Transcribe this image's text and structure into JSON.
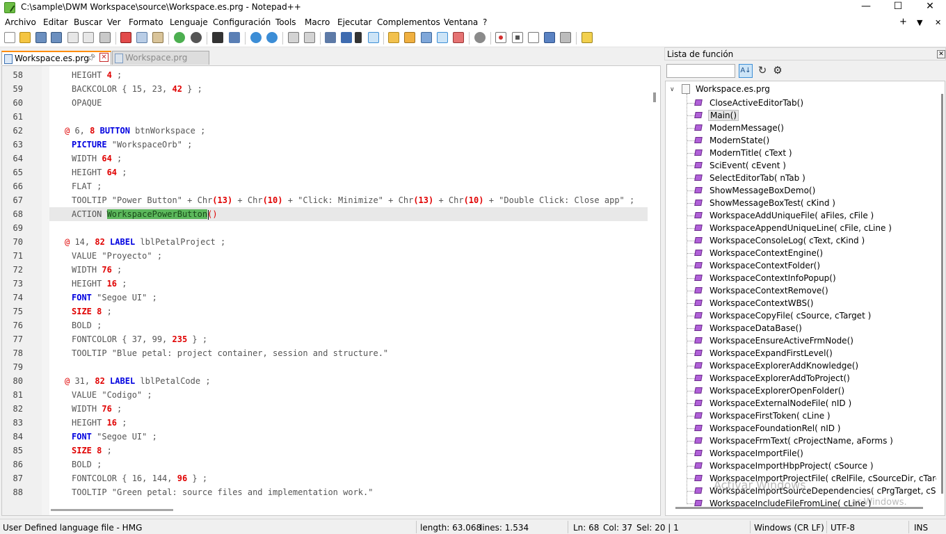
{
  "window": {
    "title": "C:\\sample\\DWM Workspace\\source\\Workspace.es.prg - Notepad++",
    "minimize": "—",
    "maximize": "☐",
    "close": "✕"
  },
  "menu": {
    "items": [
      "Archivo",
      "Editar",
      "Buscar",
      "Ver",
      "Formato",
      "Lenguaje",
      "Configuración",
      "Tools",
      "Macro",
      "Ejecutar",
      "Complementos",
      "Ventana",
      "?"
    ],
    "right": [
      "+",
      "▼",
      "✕"
    ]
  },
  "toolbar": {
    "icons": [
      "new-file-icon",
      "open-file-icon",
      "save-icon",
      "save-all-icon",
      "close-icon",
      "close-all-icon",
      "print-icon",
      "cut-icon",
      "copy-icon",
      "paste-icon",
      "undo-icon",
      "redo-icon",
      "find-icon",
      "replace-icon",
      "zoom-in-icon",
      "zoom-out-icon",
      "sync-v-icon",
      "sync-h-icon",
      "word-wrap-icon",
      "show-all-chars-icon",
      "indent-guide-icon",
      "lang-icon",
      "doc-map-icon",
      "doc-list-icon",
      "function-list-icon",
      "folder-workspace-icon",
      "monitor-icon",
      "record-macro-icon",
      "stop-record-icon",
      "play-macro-icon",
      "run-macro-multiple-icon",
      "save-macro-icon",
      "spell-check-icon"
    ]
  },
  "tabs": [
    {
      "label": "Workspace.es.prg",
      "active": true
    },
    {
      "label": "Workspace.prg",
      "active": false
    }
  ],
  "editor": {
    "current_line": 68,
    "lines": [
      {
        "n": "58",
        "tokens": [
          [
            "HEIGHT ",
            "t"
          ],
          [
            "4",
            "nm"
          ],
          [
            " ;",
            "t"
          ]
        ]
      },
      {
        "n": "59",
        "tokens": [
          [
            "BACKCOLOR { 15, 23, ",
            "t"
          ],
          [
            "42",
            "nm"
          ],
          [
            " } ;",
            "t"
          ]
        ]
      },
      {
        "n": "60",
        "tokens": [
          [
            "OPAQUE",
            "t"
          ]
        ]
      },
      {
        "n": "61",
        "tokens": []
      },
      {
        "n": "62",
        "indent": -1,
        "tokens": [
          [
            "@ ",
            "at"
          ],
          [
            "6, ",
            "t"
          ],
          [
            "8 ",
            "nm"
          ],
          [
            "BUTTON",
            "kw"
          ],
          [
            " btnWorkspace ;",
            "t"
          ]
        ]
      },
      {
        "n": "63",
        "tokens": [
          [
            "PICTURE",
            "kw"
          ],
          [
            " \"WorkspaceOrb\" ;",
            "t"
          ]
        ]
      },
      {
        "n": "64",
        "tokens": [
          [
            "WIDTH ",
            "t"
          ],
          [
            "64",
            "nm"
          ],
          [
            " ;",
            "t"
          ]
        ]
      },
      {
        "n": "65",
        "tokens": [
          [
            "HEIGHT ",
            "t"
          ],
          [
            "64",
            "nm"
          ],
          [
            " ;",
            "t"
          ]
        ]
      },
      {
        "n": "66",
        "tokens": [
          [
            "FLAT ;",
            "t"
          ]
        ]
      },
      {
        "n": "67",
        "tokens": [
          [
            "TOOLTIP \"Power Button\" + Chr",
            "t"
          ],
          [
            "(13)",
            "nm"
          ],
          [
            " + Chr",
            "t"
          ],
          [
            "(10)",
            "nm"
          ],
          [
            " + \"Click: Minimize\" + Chr",
            "t"
          ],
          [
            "(13)",
            "nm"
          ],
          [
            " + Chr",
            "t"
          ],
          [
            "(10)",
            "nm"
          ],
          [
            " + \"Double Click: Close app\" ;",
            "t"
          ]
        ]
      },
      {
        "n": "68",
        "tokens": [
          [
            "ACTION ",
            "t"
          ],
          [
            "WorkspacePowerButton",
            "sel"
          ],
          [
            "(",
            "br"
          ],
          [
            ")",
            "br"
          ]
        ]
      },
      {
        "n": "69",
        "tokens": []
      },
      {
        "n": "70",
        "indent": -1,
        "tokens": [
          [
            "@ ",
            "at"
          ],
          [
            "14, ",
            "t"
          ],
          [
            "82 ",
            "nm"
          ],
          [
            "LABEL",
            "kw"
          ],
          [
            " lblPetalProject ;",
            "t"
          ]
        ]
      },
      {
        "n": "71",
        "tokens": [
          [
            "VALUE \"Proyecto\" ;",
            "t"
          ]
        ]
      },
      {
        "n": "72",
        "tokens": [
          [
            "WIDTH ",
            "t"
          ],
          [
            "76",
            "nm"
          ],
          [
            " ;",
            "t"
          ]
        ]
      },
      {
        "n": "73",
        "tokens": [
          [
            "HEIGHT ",
            "t"
          ],
          [
            "16",
            "nm"
          ],
          [
            " ;",
            "t"
          ]
        ]
      },
      {
        "n": "74",
        "tokens": [
          [
            "FONT",
            "kw"
          ],
          [
            " \"Segoe UI\" ;",
            "t"
          ]
        ]
      },
      {
        "n": "75",
        "tokens": [
          [
            "SIZE",
            "nm"
          ],
          [
            " ",
            "t"
          ],
          [
            "8",
            "nm"
          ],
          [
            " ;",
            "t"
          ]
        ]
      },
      {
        "n": "76",
        "tokens": [
          [
            "BOLD ;",
            "t"
          ]
        ]
      },
      {
        "n": "77",
        "tokens": [
          [
            "FONTCOLOR { 37, 99, ",
            "t"
          ],
          [
            "235",
            "nm"
          ],
          [
            " } ;",
            "t"
          ]
        ]
      },
      {
        "n": "78",
        "tokens": [
          [
            "TOOLTIP \"Blue petal: project container, session and structure.\"",
            "t"
          ]
        ]
      },
      {
        "n": "79",
        "tokens": []
      },
      {
        "n": "80",
        "indent": -1,
        "tokens": [
          [
            "@ ",
            "at"
          ],
          [
            "31, ",
            "t"
          ],
          [
            "82 ",
            "nm"
          ],
          [
            "LABEL",
            "kw"
          ],
          [
            " lblPetalCode ;",
            "t"
          ]
        ]
      },
      {
        "n": "81",
        "tokens": [
          [
            "VALUE \"Codigo\" ;",
            "t"
          ]
        ]
      },
      {
        "n": "82",
        "tokens": [
          [
            "WIDTH ",
            "t"
          ],
          [
            "76",
            "nm"
          ],
          [
            " ;",
            "t"
          ]
        ]
      },
      {
        "n": "83",
        "tokens": [
          [
            "HEIGHT ",
            "t"
          ],
          [
            "16",
            "nm"
          ],
          [
            " ;",
            "t"
          ]
        ]
      },
      {
        "n": "84",
        "tokens": [
          [
            "FONT",
            "kw"
          ],
          [
            " \"Segoe UI\" ;",
            "t"
          ]
        ]
      },
      {
        "n": "85",
        "tokens": [
          [
            "SIZE",
            "nm"
          ],
          [
            " ",
            "t"
          ],
          [
            "8",
            "nm"
          ],
          [
            " ;",
            "t"
          ]
        ]
      },
      {
        "n": "86",
        "tokens": [
          [
            "BOLD ;",
            "t"
          ]
        ]
      },
      {
        "n": "87",
        "tokens": [
          [
            "FONTCOLOR { 16, 144, ",
            "t"
          ],
          [
            "96",
            "nm"
          ],
          [
            " } ;",
            "t"
          ]
        ]
      },
      {
        "n": "88",
        "tokens": [
          [
            "TOOLTIP \"Green petal: source files and implementation work.\"",
            "t"
          ]
        ]
      }
    ]
  },
  "function_list": {
    "title": "Lista de función",
    "search_value": "",
    "root": "Workspace.es.prg",
    "selected": "Main()",
    "items": [
      "CloseActiveEditorTab()",
      "Main()",
      "ModernMessage()",
      "ModernState()",
      "ModernTitle( cText )",
      "SciEvent( cEvent )",
      "SelectEditorTab( nTab )",
      "ShowMessageBoxDemo()",
      "ShowMessageBoxTest( cKind )",
      "WorkspaceAddUniqueFile( aFiles, cFile )",
      "WorkspaceAppendUniqueLine( cFile, cLine )",
      "WorkspaceConsoleLog( cText, cKind )",
      "WorkspaceContextEngine()",
      "WorkspaceContextFolder()",
      "WorkspaceContextInfoPopup()",
      "WorkspaceContextRemove()",
      "WorkspaceContextWBS()",
      "WorkspaceCopyFile( cSource, cTarget )",
      "WorkspaceDataBase()",
      "WorkspaceEnsureActiveFrmNode()",
      "WorkspaceExpandFirstLevel()",
      "WorkspaceExplorerAddKnowledge()",
      "WorkspaceExplorerAddToProject()",
      "WorkspaceExplorerOpenFolder()",
      "WorkspaceExternalNodeFile( nID )",
      "WorkspaceFirstToken( cLine )",
      "WorkspaceFoundationRel( nID )",
      "WorkspaceFrmText( cProjectName, aForms )",
      "WorkspaceImportFile()",
      "WorkspaceImportHbpProject( cSource )",
      "WorkspaceImportProjectFile( cRelFile, cSourceDir, cTargetDir )",
      "WorkspaceImportSourceDependencies( cPrgTarget, cSourceDir )",
      "WorkspaceIncludeFileFromLine( cLine )"
    ]
  },
  "watermark": {
    "line1": "Activar Windows",
    "line2": "ar Windows."
  },
  "status": {
    "language": "User Defined language file - HMG",
    "length": "length: 63.068",
    "lines": "lines: 1.534",
    "ln": "Ln: 68",
    "col": "Col: 37",
    "sel": "Sel: 20 | 1",
    "eol": "Windows (CR LF)",
    "encoding": "UTF-8",
    "mode": "INS"
  },
  "colors": {
    "keyword": "#0000e0",
    "number": "#e00000",
    "selection": "#5cb85c",
    "tab_accent": "#ff8c00",
    "function_icon": "#b060d8"
  }
}
